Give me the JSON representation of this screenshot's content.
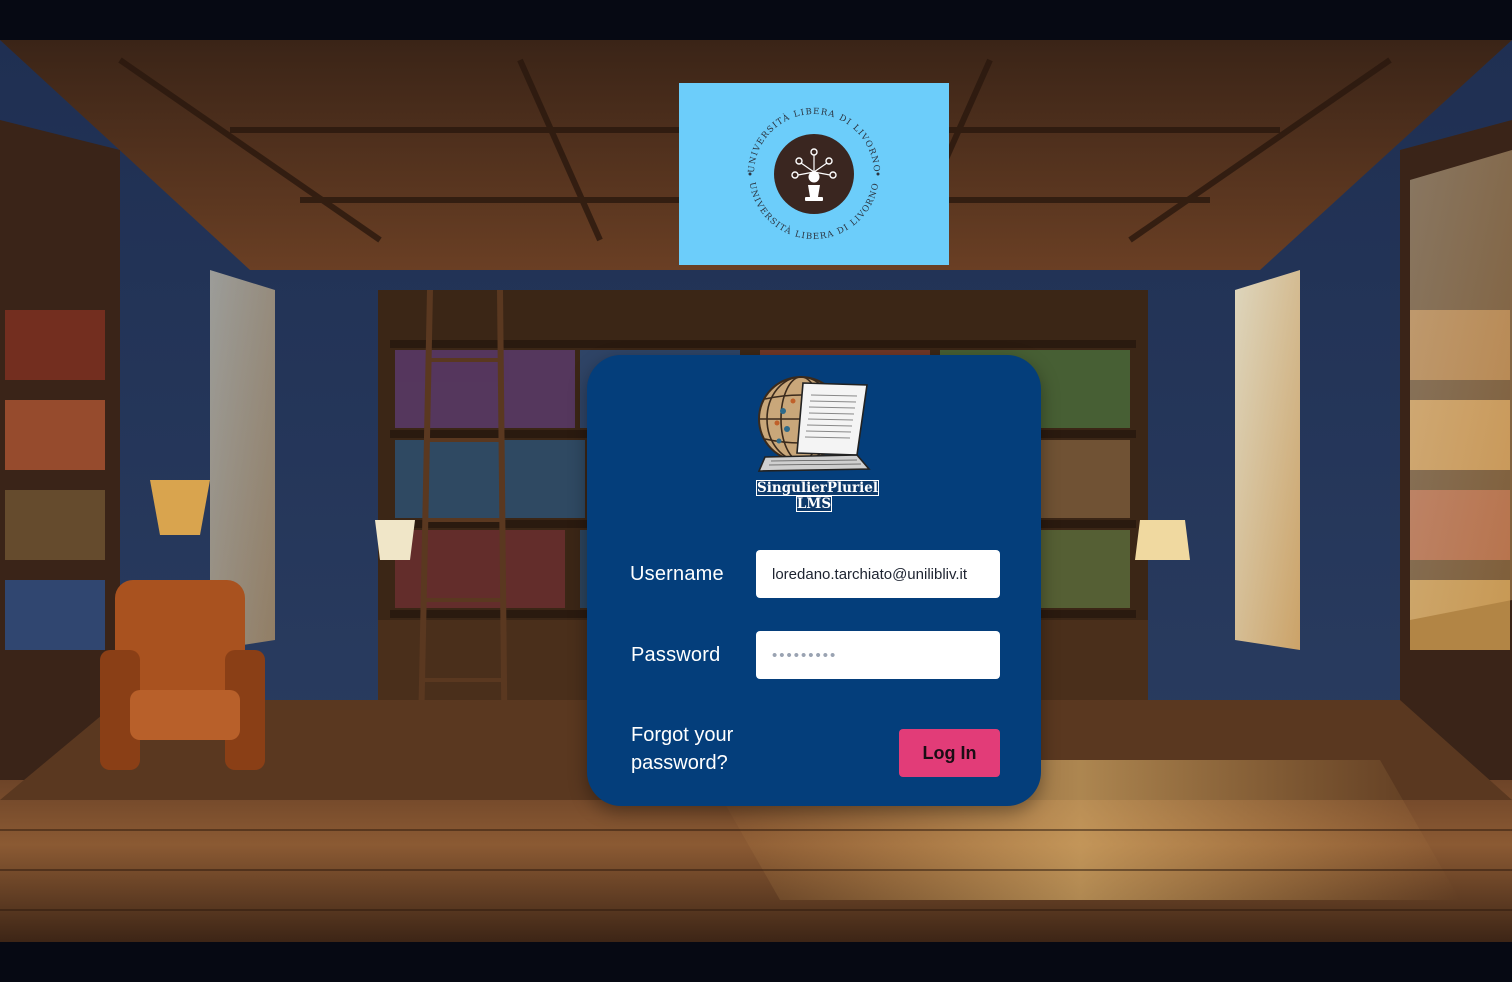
{
  "university": {
    "seal_text_top": "UNIVERSITÀ LIBERA DI LIVORNO",
    "seal_text_bottom": "UNIVERSITÀ LIBERA DI LIVORNO",
    "logo_icon": "chess-pawn-network-icon",
    "background_color": "#6ccdfa"
  },
  "app": {
    "name_line1": "SingulierPluriel",
    "name_line2": "LMS",
    "logo_icon": "globe-laptop-document-icon"
  },
  "login": {
    "username_label": "Username",
    "username_value": "loredano.tarchiato@unilibliv.it",
    "password_label": "Password",
    "password_value": "•••••••••",
    "forgot_password": "Forgot your password?",
    "login_button": "Log In"
  },
  "colors": {
    "card": "#043e7b",
    "button": "#e23c78",
    "input_bg": "#ffffff"
  }
}
